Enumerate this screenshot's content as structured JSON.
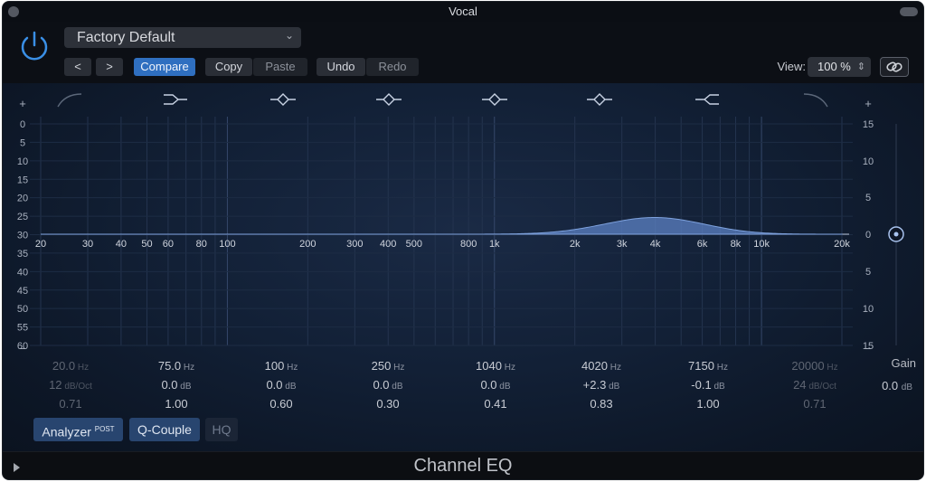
{
  "window": {
    "title": "Vocal"
  },
  "header": {
    "preset": "Factory Default",
    "prev_label": "<",
    "next_label": ">",
    "compare_label": "Compare",
    "copy_label": "Copy",
    "paste_label": "Paste",
    "undo_label": "Undo",
    "redo_label": "Redo",
    "view_label": "View:",
    "view_value": "100 %"
  },
  "eq": {
    "left_scale": [
      "+",
      "0",
      "5",
      "10",
      "15",
      "20",
      "25",
      "30",
      "35",
      "40",
      "45",
      "50",
      "55",
      "60",
      "−"
    ],
    "right_scale": [
      "+",
      "15",
      "10",
      "5",
      "0",
      "5",
      "10",
      "15",
      "−"
    ],
    "freq_labels": [
      "20",
      "30",
      "40",
      "50",
      "60",
      "80",
      "100",
      "200",
      "300",
      "400",
      "500",
      "800",
      "1k",
      "2k",
      "3k",
      "4k",
      "6k",
      "8k",
      "10k",
      "20k"
    ],
    "bands": [
      {
        "freq": "20.0",
        "freq_unit": "Hz",
        "gain": "12",
        "gain_unit": "dB/Oct",
        "q": "0.71",
        "active": false,
        "icon": "low-cut-icon"
      },
      {
        "freq": "75.0",
        "freq_unit": "Hz",
        "gain": "0.0",
        "gain_unit": "dB",
        "q": "1.00",
        "active": true,
        "icon": "low-shelf-icon"
      },
      {
        "freq": "100",
        "freq_unit": "Hz",
        "gain": "0.0",
        "gain_unit": "dB",
        "q": "0.60",
        "active": true,
        "icon": "bell-icon"
      },
      {
        "freq": "250",
        "freq_unit": "Hz",
        "gain": "0.0",
        "gain_unit": "dB",
        "q": "0.30",
        "active": true,
        "icon": "bell-icon"
      },
      {
        "freq": "1040",
        "freq_unit": "Hz",
        "gain": "0.0",
        "gain_unit": "dB",
        "q": "0.41",
        "active": true,
        "icon": "bell-icon"
      },
      {
        "freq": "4020",
        "freq_unit": "Hz",
        "gain": "+2.3",
        "gain_unit": "dB",
        "q": "0.83",
        "active": true,
        "icon": "bell-icon"
      },
      {
        "freq": "7150",
        "freq_unit": "Hz",
        "gain": "-0.1",
        "gain_unit": "dB",
        "q": "1.00",
        "active": true,
        "icon": "high-shelf-icon"
      },
      {
        "freq": "20000",
        "freq_unit": "Hz",
        "gain": "24",
        "gain_unit": "dB/Oct",
        "q": "0.71",
        "active": false,
        "icon": "high-cut-icon"
      }
    ],
    "gain_label": "Gain",
    "gain_value": "0.0",
    "gain_unit": "dB",
    "curve_color": "#5c82c4"
  },
  "bottom": {
    "analyzer_label": "Analyzer",
    "analyzer_sup": "POST",
    "qcouple_label": "Q-Couple",
    "hq_label": "HQ"
  },
  "footer": {
    "title": "Channel EQ"
  }
}
